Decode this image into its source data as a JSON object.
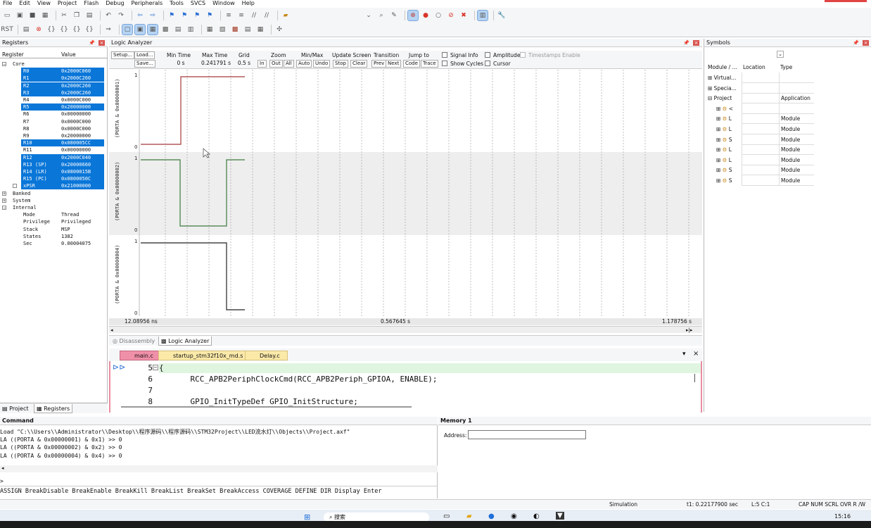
{
  "menu": [
    "File",
    "Edit",
    "View",
    "Project",
    "Flash",
    "Debug",
    "Peripherals",
    "Tools",
    "SVCS",
    "Window",
    "Help"
  ],
  "registers": {
    "title": "Registers",
    "col_register": "Register",
    "col_value": "Value",
    "groups": {
      "core": "Core",
      "banked": "Banked",
      "system": "System",
      "internal": "Internal"
    },
    "core": [
      {
        "name": "R0",
        "value": "0x2000C060",
        "sel": true
      },
      {
        "name": "R1",
        "value": "0x2000C260",
        "sel": true
      },
      {
        "name": "R2",
        "value": "0x2000C260",
        "sel": true
      },
      {
        "name": "R3",
        "value": "0x2000C260",
        "sel": true
      },
      {
        "name": "R4",
        "value": "0x0000C000",
        "sel": false
      },
      {
        "name": "R5",
        "value": "0x20000000",
        "sel": true
      },
      {
        "name": "R6",
        "value": "0x00000000",
        "sel": false
      },
      {
        "name": "R7",
        "value": "0x0000C000",
        "sel": false
      },
      {
        "name": "R8",
        "value": "0x0000C000",
        "sel": false
      },
      {
        "name": "R9",
        "value": "0x20000000",
        "sel": false
      },
      {
        "name": "R10",
        "value": "0x080005CC",
        "sel": true
      },
      {
        "name": "R11",
        "value": "0x00000000",
        "sel": false
      },
      {
        "name": "R12",
        "value": "0x2000C040",
        "sel": true
      },
      {
        "name": "R13 (SP)",
        "value": "0x20000660",
        "sel": true
      },
      {
        "name": "R14 (LR)",
        "value": "0x0800015B",
        "sel": true
      },
      {
        "name": "R15 (PC)",
        "value": "0x0800050C",
        "sel": true
      },
      {
        "name": "xPSR",
        "value": "0x21000000",
        "sel": true
      }
    ],
    "internal": [
      {
        "name": "Mode",
        "value": "Thread"
      },
      {
        "name": "Privilege",
        "value": "Privileged"
      },
      {
        "name": "Stack",
        "value": "MSP"
      },
      {
        "name": "States",
        "value": "1382"
      },
      {
        "name": "Sec",
        "value": "0.00004075"
      }
    ],
    "tab_project": "Project",
    "tab_registers": "Registers"
  },
  "logic": {
    "title": "Logic Analyzer",
    "setup": "Setup...",
    "load": "Load...",
    "save": "Save...",
    "min_time_label": "Min Time",
    "min_time": "0 s",
    "max_time_label": "Max Time",
    "max_time": "0.241791 s",
    "grid_label": "Grid",
    "grid": "0.5 s",
    "zoom_label": "Zoom",
    "zoom_in": "In",
    "zoom_out": "Out",
    "zoom_all": "All",
    "minmax_label": "Min/Max",
    "auto": "Auto",
    "undo": "Undo",
    "update_label": "Update Screen",
    "stop": "Stop",
    "clear": "Clear",
    "transition_label": "Transition",
    "prev": "Prev",
    "next": "Next",
    "jump_label": "Jump to",
    "code": "Code",
    "trace": "Trace",
    "signal_info": "Signal Info",
    "show_cycles": "Show Cycles",
    "amplitude": "Amplitude",
    "cursor": "Cursor",
    "timestamps": "Timestamps Enable",
    "signals": [
      "(PORTA & 0x00000001)",
      "(PORTA & 0x00000002)",
      "(PORTA & 0x00000004)"
    ],
    "level_high": "1",
    "level_low": "0",
    "t_left": "12.08956 ns",
    "t_mid": "0.567645 s",
    "t_right": "1.178756 s",
    "tab_disassembly": "Disassembly",
    "tab_logic": "Logic Analyzer"
  },
  "editor": {
    "tabs": [
      "main.c",
      "startup_stm32f10x_md.s",
      "Delay.c"
    ],
    "lines": [
      {
        "num": "5",
        "text": "{"
      },
      {
        "num": "6",
        "text": "    RCC_APB2PeriphClockCmd(RCC_APB2Periph_GPIOA, ENABLE);"
      },
      {
        "num": "7",
        "text": ""
      },
      {
        "num": "8",
        "text": "    GPIO_InitTypeDef GPIO_InitStructure;"
      }
    ]
  },
  "symbols": {
    "title": "Symbols",
    "col_module": "Module / ...",
    "col_location": "Location",
    "col_type": "Type",
    "rows": [
      {
        "name": "Virtual...",
        "type": "",
        "indent": 0,
        "icon": false
      },
      {
        "name": "Specia...",
        "type": "",
        "indent": 0,
        "icon": false
      },
      {
        "name": "Project",
        "type": "Application",
        "indent": 0,
        "icon": false
      },
      {
        "name": "<",
        "type": "",
        "indent": 1,
        "icon": true
      },
      {
        "name": "L",
        "type": "Module",
        "indent": 1,
        "icon": true
      },
      {
        "name": "L",
        "type": "Module",
        "indent": 1,
        "icon": true
      },
      {
        "name": "S",
        "type": "Module",
        "indent": 1,
        "icon": true
      },
      {
        "name": "L",
        "type": "Module",
        "indent": 1,
        "icon": true
      },
      {
        "name": "L",
        "type": "Module",
        "indent": 1,
        "icon": true
      },
      {
        "name": "S",
        "type": "Module",
        "indent": 1,
        "icon": true
      },
      {
        "name": "S",
        "type": "Module",
        "indent": 1,
        "icon": true
      }
    ]
  },
  "command": {
    "title": "Command",
    "lines": [
      "Load \"C:\\\\Users\\\\Administrator\\\\Desktop\\\\程序源码\\\\程序源码\\\\STM32Project\\\\LED流水灯\\\\Objects\\\\Project.axf\"",
      "LA ((PORTA & 0x00000001) & 0x1) >> 0",
      "LA ((PORTA & 0x00000002) & 0x2) >> 0",
      "LA ((PORTA & 0x00000004) & 0x4) >> 0"
    ],
    "prompt": ">",
    "hint": "ASSIGN BreakDisable BreakEnable BreakKill BreakList BreakSet BreakAccess COVERAGE DEFINE DIR Display Enter"
  },
  "memory": {
    "title": "Memory 1",
    "address_label": "Address:"
  },
  "status": {
    "mode": "Simulation",
    "time": "t1: 0.22177900 sec",
    "pos": "L:5 C:1",
    "keys": "CAP  NUM  SCRL  OVR  R /W"
  },
  "taskbar": {
    "search": "搜索",
    "clock": "15:16"
  },
  "colors": {
    "selection": "#0a76d8",
    "sig1": "#a33a3a",
    "sig2": "#3d7a3d",
    "sig3": "#222222",
    "editor_tab_active": "#f08fa8",
    "editor_tab": "#fbe9a8"
  }
}
